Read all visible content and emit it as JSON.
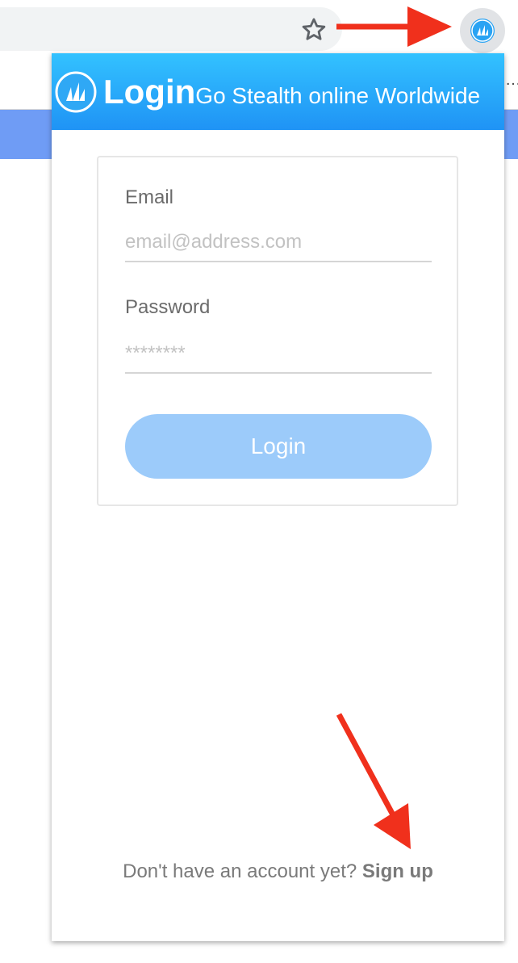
{
  "header": {
    "title": "Login",
    "tagline": "Go Stealth online Worldwide"
  },
  "form": {
    "email_label": "Email",
    "email_placeholder": "email@address.com",
    "password_label": "Password",
    "password_placeholder": "********",
    "login_label": "Login"
  },
  "footer": {
    "prompt": "Don't have an account yet?",
    "signup_label": "Sign up"
  },
  "browser": {
    "overflow_glyph": "…"
  },
  "colors": {
    "header_top": "#33c2ff",
    "header_bottom": "#1f93f5",
    "button": "#9ccbfa",
    "annotation": "#f0301c"
  },
  "icons": [
    "star-icon",
    "extension-logo-icon",
    "arrow-annotation"
  ]
}
